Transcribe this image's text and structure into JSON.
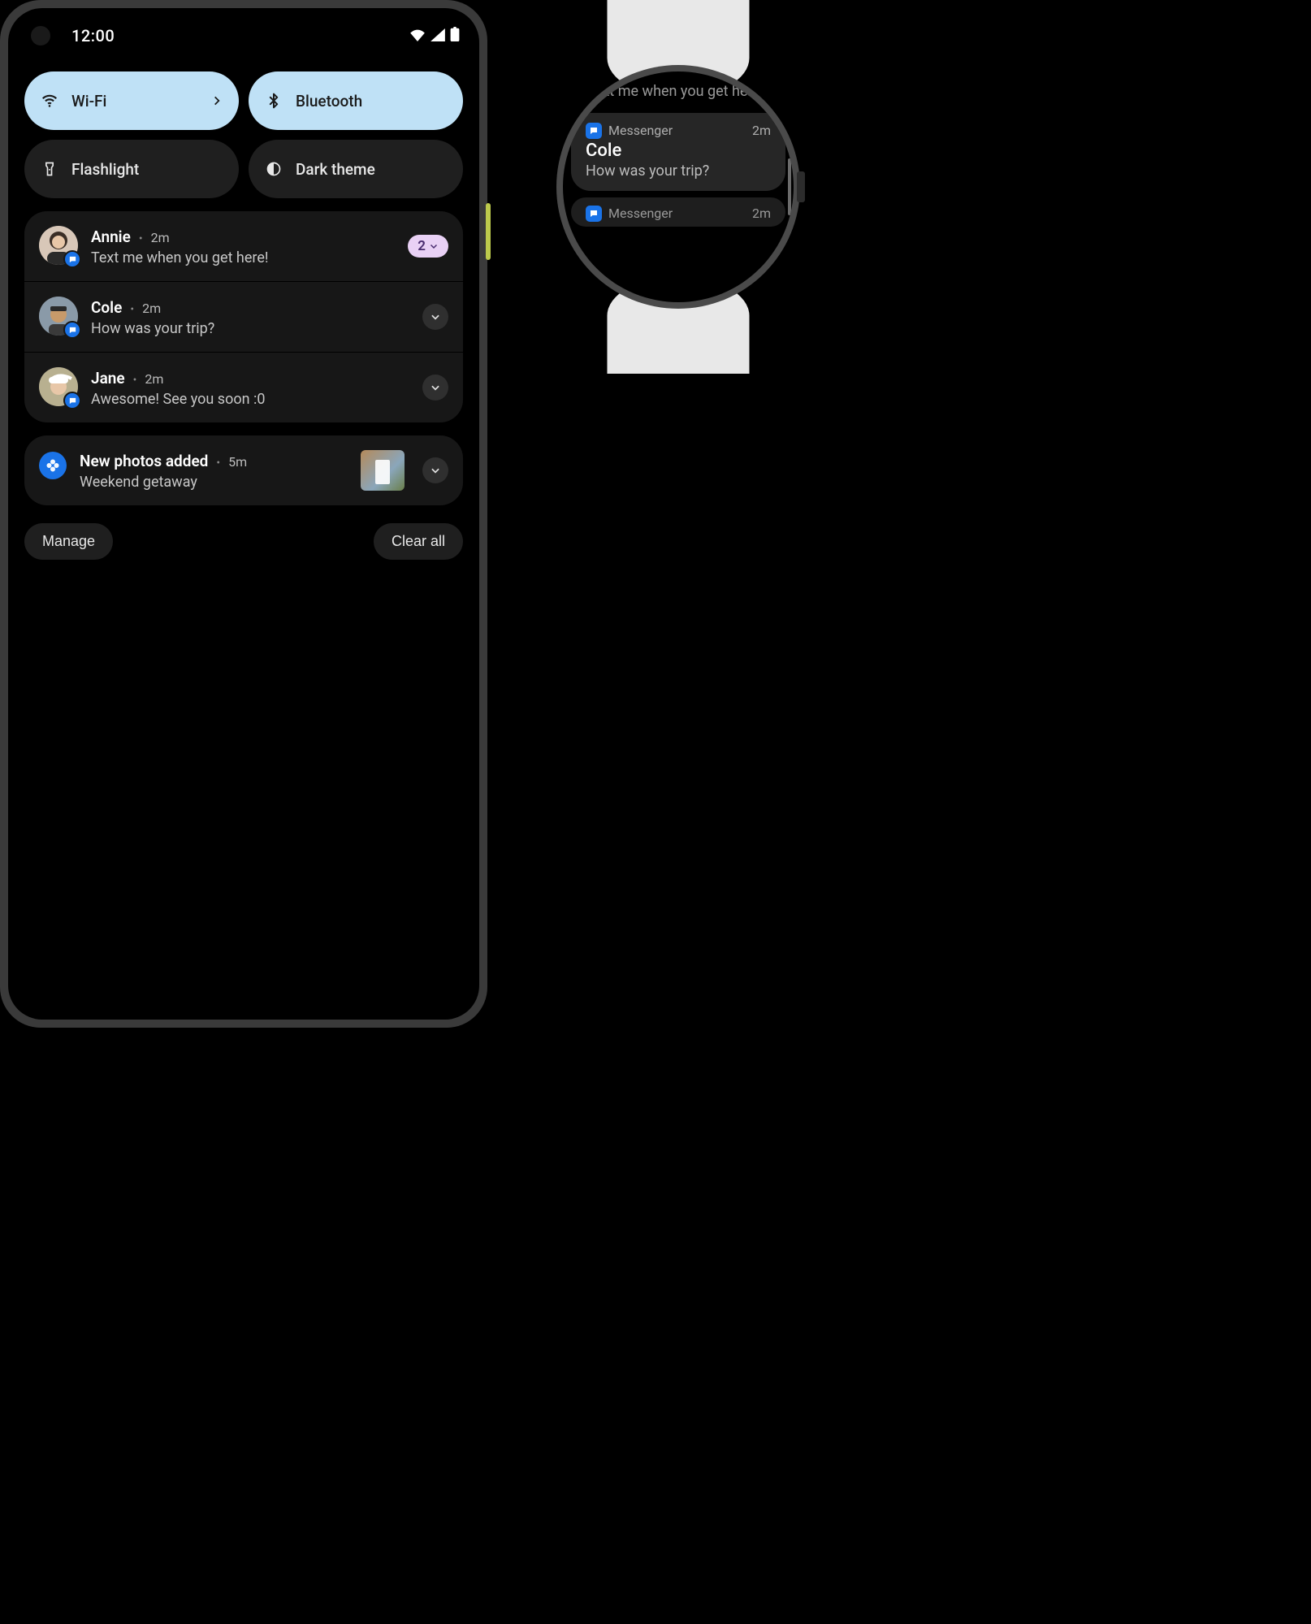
{
  "status": {
    "time": "12:00"
  },
  "qs": {
    "wifi": {
      "label": "Wi-Fi",
      "active": true
    },
    "bluetooth": {
      "label": "Bluetooth",
      "active": true
    },
    "flashlight": {
      "label": "Flashlight",
      "active": false
    },
    "darktheme": {
      "label": "Dark theme",
      "active": false
    }
  },
  "notifications": {
    "messages": [
      {
        "sender": "Annie",
        "time": "2m",
        "text": "Text me when you get here!",
        "count": "2"
      },
      {
        "sender": "Cole",
        "time": "2m",
        "text": "How was your trip?"
      },
      {
        "sender": "Jane",
        "time": "2m",
        "text": "Awesome! See you soon :0"
      }
    ],
    "photos": {
      "title": "New photos added",
      "time": "5m",
      "subtitle": "Weekend getaway"
    }
  },
  "actions": {
    "manage": "Manage",
    "clear": "Clear all"
  },
  "watch": {
    "prev_text": "…xt me when you get here!",
    "app": "Messenger",
    "time": "2m",
    "sender": "Cole",
    "msg": "How was your trip?",
    "next_app": "Messenger",
    "next_time": "2m"
  },
  "colors": {
    "tile_active": "#bfe1f6",
    "tile_inactive": "#1f1f1f",
    "chip": "#e9d1f5",
    "blue": "#1a73e8"
  }
}
